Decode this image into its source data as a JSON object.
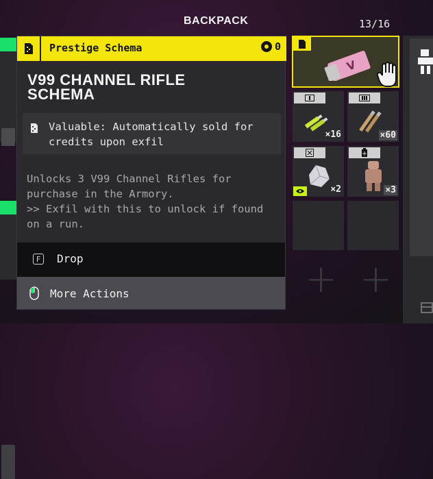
{
  "backpack": {
    "title": "BACKPACK",
    "count": "13/16"
  },
  "tooltip": {
    "category": "Prestige Schema",
    "credit_value": "0",
    "title_line1": "V99 CHANNEL RIFLE",
    "title_line2": "SCHEMA",
    "valuable_text": "Valuable: Automatically sold for credits upon exfil",
    "description": "Unlocks 3 V99 Channel Rifles for purchase in the Armory.\n>> Exfil with this to unlock if found on a run.",
    "drop_key": "F",
    "drop_label": "Drop",
    "more_label": "More Actions"
  },
  "grid": {
    "items": [
      {
        "name": "V99 Channel Rifle Schema",
        "selected": true,
        "icon": "schema-card-icon"
      },
      {
        "qty": "×16",
        "icon": "ammo-icon"
      },
      {
        "qty": "×60",
        "icon": "ammo-icon"
      },
      {
        "qty": "×2",
        "icon": "crystal-icon",
        "watched": true
      },
      {
        "qty": "×3",
        "icon": "figure-icon"
      }
    ]
  },
  "colors": {
    "accent": "#f4e60c",
    "green": "#18e06a",
    "panel": "#2a2a2e"
  }
}
